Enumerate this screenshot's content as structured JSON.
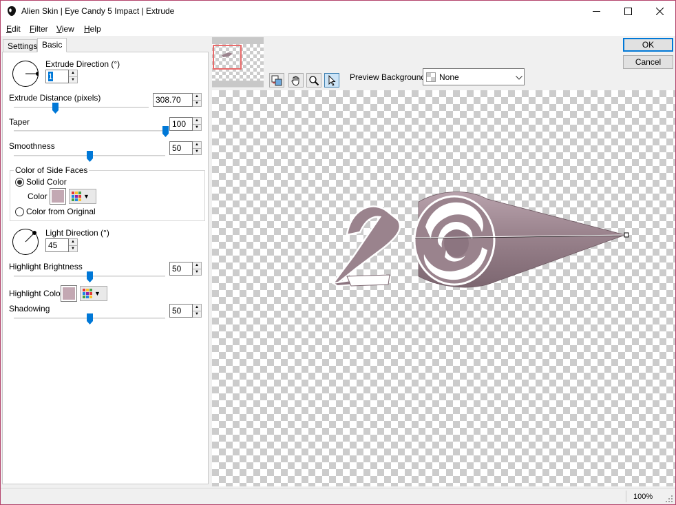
{
  "window": {
    "title": "Alien Skin | Eye Candy 5 Impact | Extrude",
    "minimize_icon": "minimize-icon",
    "maximize_icon": "maximize-icon",
    "close_icon": "close-icon"
  },
  "menu": [
    {
      "key": "E",
      "rest": "dit"
    },
    {
      "key": "F",
      "rest": "ilter"
    },
    {
      "key": "V",
      "rest": "iew"
    },
    {
      "key": "H",
      "rest": "elp"
    }
  ],
  "tabs": {
    "settings": "Settings",
    "basic": "Basic"
  },
  "basic": {
    "extrude_direction": {
      "label": "Extrude Direction (°)",
      "value": "1"
    },
    "extrude_distance": {
      "label": "Extrude Distance (pixels)",
      "value": "308.70",
      "fraction": 0.31
    },
    "taper": {
      "label": "Taper",
      "value": "100",
      "fraction": 1.0
    },
    "smoothness": {
      "label": "Smoothness",
      "value": "50",
      "fraction": 0.5
    },
    "side_faces": {
      "group_label": "Color of Side Faces",
      "solid_color": "Solid Color",
      "color_label": "Color",
      "from_original": "Color from Original",
      "color": "#c3a8b3"
    },
    "light_direction": {
      "label": "Light Direction (°)",
      "value": "45"
    },
    "highlight_brightness": {
      "label": "Highlight Brightness",
      "value": "50",
      "fraction": 0.5
    },
    "highlight_color": {
      "label": "Highlight Color",
      "color": "#c3a8b3"
    },
    "shadowing": {
      "label": "Shadowing",
      "value": "50",
      "fraction": 0.5
    }
  },
  "toolbar": {
    "tools": [
      "swap-preview-icon",
      "hand-icon",
      "zoom-icon",
      "arrow-pointer-icon"
    ],
    "preview_background_label": "Preview Background:",
    "preview_background_value": "None"
  },
  "buttons": {
    "ok": "OK",
    "cancel": "Cancel"
  },
  "status": {
    "zoom": "100%"
  },
  "colors": {
    "object_fill": "#9a838d",
    "object_highlight": "#ffffff",
    "accent": "#0078d7"
  }
}
